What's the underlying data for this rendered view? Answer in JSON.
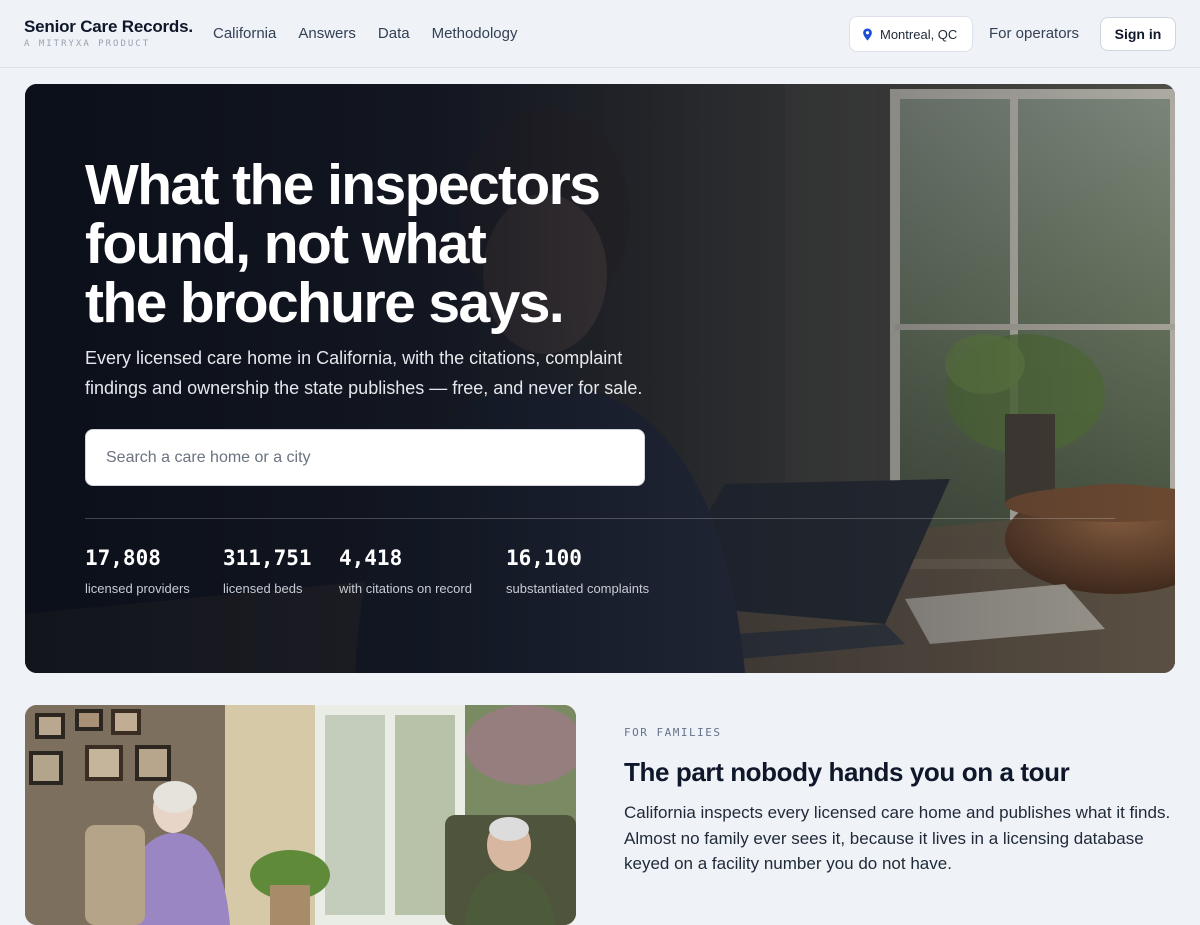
{
  "brand": {
    "name": "Senior Care Records.",
    "tagline": "A MITRYXA PRODUCT"
  },
  "nav": {
    "links": [
      "California",
      "Answers",
      "Data",
      "Methodology"
    ]
  },
  "header": {
    "location": "Montreal, QC",
    "operators_link": "For operators",
    "sign_in_label": "Sign in"
  },
  "hero": {
    "title_lines": [
      "What the inspectors",
      "found, not what",
      "the brochure says."
    ],
    "subtitle_lines": [
      "Every licensed care home in California, with the citations, complaint",
      "findings and ownership the state publishes — free, and never for sale."
    ],
    "search_placeholder": "Search a care home or a city",
    "stats": [
      {
        "value": "17,808",
        "label": "licensed providers"
      },
      {
        "value": "311,751",
        "label": "licensed beds"
      },
      {
        "value": "4,418",
        "label": "with citations on record"
      },
      {
        "value": "16,100",
        "label": "substantiated complaints"
      }
    ]
  },
  "families": {
    "kicker": "FOR FAMILIES",
    "title": "The part nobody hands you on a tour",
    "body_lines": [
      "California inspects every licensed care home and publishes what it finds.",
      "Almost no family ever sees it, because it lives in a licensing database",
      "keyed on a facility number you do not have."
    ]
  },
  "colors": {
    "page_background": "#eff2f7",
    "text_dark": "#0f172a",
    "location_pin": "#1d4ed8",
    "hero_overlay": "#0a0e18"
  },
  "icons": {
    "location": "map-pin-icon"
  }
}
